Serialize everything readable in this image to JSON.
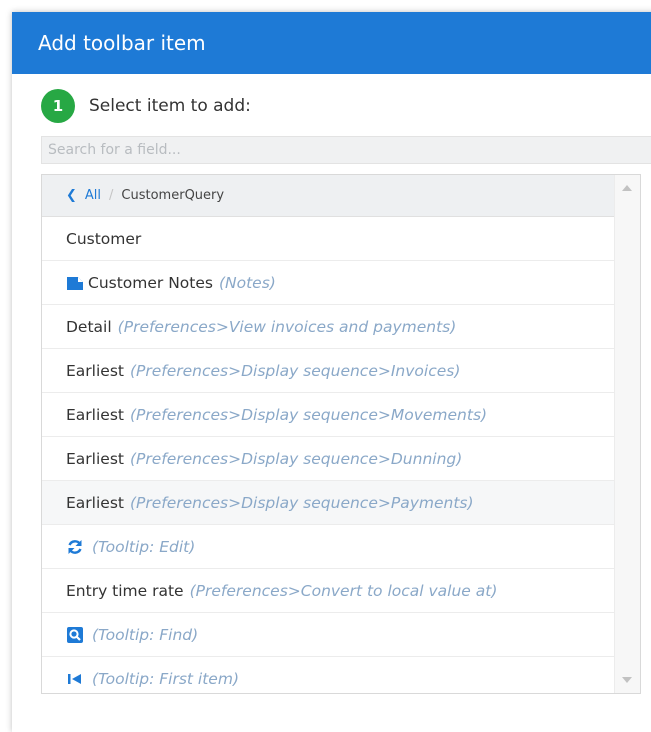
{
  "dialog": {
    "title": "Add toolbar item"
  },
  "step": {
    "number": "1",
    "label": "Select item to add:"
  },
  "search": {
    "placeholder": "Search for a field...",
    "value": ""
  },
  "breadcrumb": {
    "root": "All",
    "current": "CustomerQuery"
  },
  "colors": {
    "header": "#1e7ad6",
    "step_badge": "#27a844",
    "hint": "#8aa8c8",
    "link": "#1e7ad6"
  },
  "items": [
    {
      "label": "Customer",
      "hint": ""
    },
    {
      "icon": "notes-icon",
      "label": "Customer Notes",
      "hint": "(Notes)"
    },
    {
      "label": "Detail",
      "hint": "(Preferences>View invoices and payments)"
    },
    {
      "label": "Earliest",
      "hint": "(Preferences>Display sequence>Invoices)"
    },
    {
      "label": "Earliest",
      "hint": "(Preferences>Display sequence>Movements)"
    },
    {
      "label": "Earliest",
      "hint": "(Preferences>Display sequence>Dunning)"
    },
    {
      "label": "Earliest",
      "hint": "(Preferences>Display sequence>Payments)"
    },
    {
      "icon": "refresh-icon",
      "label": "",
      "hint": "(Tooltip: Edit)"
    },
    {
      "label": "Entry time rate",
      "hint": "(Preferences>Convert to local value at)"
    },
    {
      "icon": "find-icon",
      "label": "",
      "hint": "(Tooltip: Find)"
    },
    {
      "icon": "first-item-icon",
      "label": "",
      "hint": "(Tooltip: First item)"
    }
  ]
}
